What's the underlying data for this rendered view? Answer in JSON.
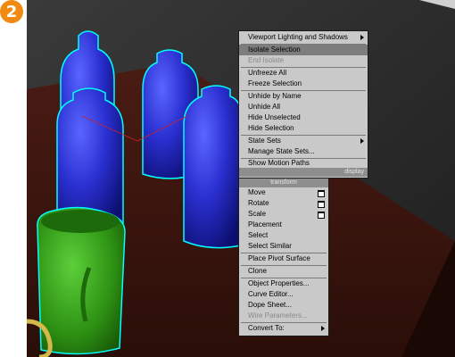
{
  "step_number": "2",
  "colors": {
    "highlight": "#7d7d7d",
    "menu_bg": "#c9c9c9",
    "section_bg": "#8e8e8e"
  },
  "quad_menu": {
    "display_section_label": "display",
    "display_items": [
      {
        "label": "Viewport Lighting and Shadows",
        "submenu": true
      },
      {
        "label": "Isolate Selection",
        "highlighted": true
      },
      {
        "label": "End Isolate",
        "disabled": true
      },
      {
        "label": "Unfreeze All"
      },
      {
        "label": "Freeze Selection"
      },
      {
        "label": "Unhide by Name"
      },
      {
        "label": "Unhide All"
      },
      {
        "label": "Hide Unselected"
      },
      {
        "label": "Hide Selection"
      },
      {
        "label": "State Sets",
        "submenu": true
      },
      {
        "label": "Manage State Sets..."
      },
      {
        "label": "Show Motion Paths"
      }
    ],
    "transform_section_label": "transform",
    "transform_items": [
      {
        "label": "Move",
        "options_icon": true
      },
      {
        "label": "Rotate",
        "options_icon": true
      },
      {
        "label": "Scale",
        "options_icon": true
      },
      {
        "label": "Placement"
      },
      {
        "label": "Select"
      },
      {
        "label": "Select Similar"
      },
      {
        "label": "Place Pivot Surface"
      },
      {
        "label": "Clone"
      },
      {
        "label": "Object Properties..."
      },
      {
        "label": "Curve Editor..."
      },
      {
        "label": "Dope Sheet..."
      },
      {
        "label": "Wire Parameters...",
        "disabled": true
      },
      {
        "label": "Convert To:",
        "submenu": true
      }
    ]
  }
}
